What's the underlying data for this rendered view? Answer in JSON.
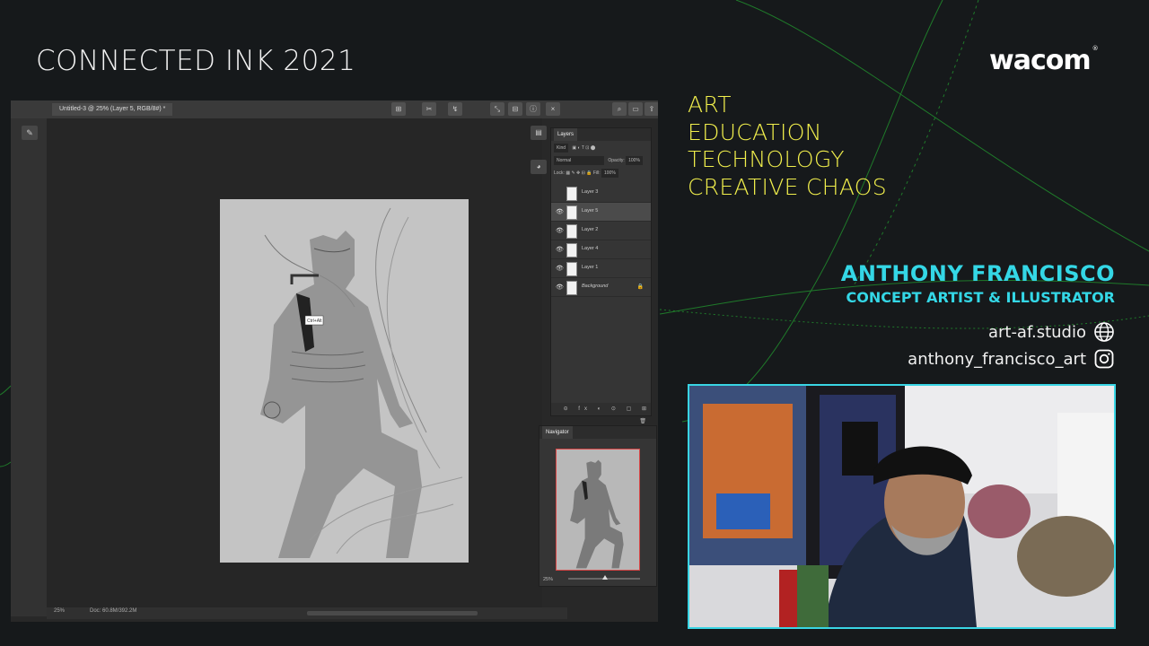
{
  "event": {
    "title": "CONNECTED INK 2021"
  },
  "brand": {
    "logo_text": "wacom",
    "trademark": "®"
  },
  "taglines": [
    "ART",
    "EDUCATION",
    "TECHNOLOGY",
    "CREATIVE CHAOS"
  ],
  "presenter": {
    "name": "ANTHONY FRANCISCO",
    "role": "CONCEPT ARTIST & ILLUSTRATOR",
    "website": "art-af.studio",
    "instagram": "anthony_francisco_art"
  },
  "photoshop": {
    "document_tab": "Untitled-3 @ 25% (Layer 5, RGB/8#) *",
    "layers_panel": {
      "title": "Layers",
      "kind_filter": "Kind",
      "blend_mode": "Normal",
      "opacity_label": "Opacity:",
      "opacity_value": "100%",
      "lock_label": "Lock:",
      "fill_label": "Fill:",
      "fill_value": "100%",
      "layers": [
        {
          "name": "Layer 3",
          "visible": false,
          "selected": false
        },
        {
          "name": "Layer 5",
          "visible": true,
          "selected": true
        },
        {
          "name": "Layer 2",
          "visible": true,
          "selected": false
        },
        {
          "name": "Layer 4",
          "visible": true,
          "selected": false
        },
        {
          "name": "Layer 1",
          "visible": true,
          "selected": false
        },
        {
          "name": "Background",
          "visible": true,
          "selected": false,
          "locked": true
        }
      ]
    },
    "navigator_panel": {
      "title": "Navigator",
      "zoom": "25%"
    },
    "status": {
      "zoom": "25%",
      "doc_info": "Doc: 60.8M/392.2M"
    },
    "cursor_tooltip": "Ctrl+Alt"
  },
  "colors": {
    "background": "#16191b",
    "tagline": "#f1ef4c",
    "accent_cyan": "#34d7e6",
    "line_green": "#1f8a2a"
  }
}
